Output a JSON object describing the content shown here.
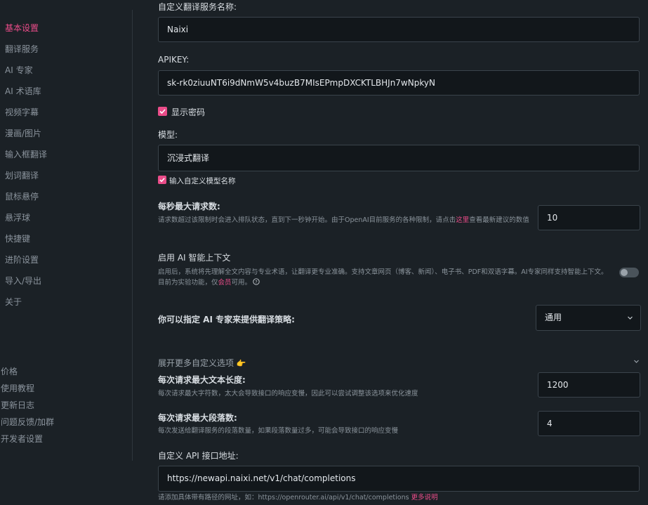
{
  "sidebar": {
    "items": [
      "基本设置",
      "翻译服务",
      "AI 专家",
      "AI 术语库",
      "视频字幕",
      "漫画/图片",
      "输入框翻译",
      "划词翻译",
      "鼠标悬停",
      "悬浮球",
      "快捷键",
      "进阶设置",
      "导入/导出",
      "关于"
    ],
    "bottom": [
      "价格",
      "使用教程",
      "更新日志",
      "问题反馈/加群",
      "开发者设置"
    ]
  },
  "form": {
    "service_name_label": "自定义翻译服务名称:",
    "service_name_value": "Naixi",
    "apikey_label": "APIKEY:",
    "apikey_value": "sk-rk0ziuuNT6i9dNmW5v4buzB7MIsEPmpDXCKTLBHJn7wNpkyN",
    "show_password_label": "显示密码",
    "model_label": "模型:",
    "model_value": "沉浸式翻译",
    "custom_model_label": "输入自定义模型名称",
    "max_rps_label": "每秒最大请求数:",
    "max_rps_desc_before": "请求数超过该限制时会进入排队状态，直到下一秒钟开始。由于OpenAI目前服务的各种限制，请点击",
    "max_rps_desc_link": "这里",
    "max_rps_desc_after": "查看最新建议的数值",
    "max_rps_value": "10",
    "ai_context_label": "启用 AI 智能上下文",
    "ai_context_desc_before": "启用后，系统将先理解全文内容与专业术语，让翻译更专业准确。支持文章网页（博客、新闻）、电子书、PDF和双语字幕。AI专家同样支持智能上下文。目前为实验功能，仅",
    "ai_context_desc_link": "会员",
    "ai_context_desc_after": "可用。",
    "ai_context_help_icon": "question-circle-icon",
    "ai_expert_label": "你可以指定 AI 专家来提供翻译策略:",
    "ai_expert_value": "通用",
    "more_options_label": "展开更多自定义选项",
    "more_options_emoji": "👉",
    "max_text_label": "每次请求最大文本长度:",
    "max_text_desc": "每次请求最大字符数，太大会导致接口的响应变慢，因此可以尝试调整该选项来优化速度",
    "max_text_value": "1200",
    "max_para_label": "每次请求最大段落数:",
    "max_para_desc": "每次发送给翻译服务的段落数量，如果段落数量过多，可能会导致接口的响应变慢",
    "max_para_value": "4",
    "api_url_label": "自定义 API 接口地址:",
    "api_url_value": "https://newapi.naixi.net/v1/chat/completions",
    "api_url_hint": "请添加具体带有路径的网址，如：https://openrouter.ai/api/v1/chat/completions",
    "api_url_hint_link": "更多说明"
  },
  "colors": {
    "accent": "#ea4c89",
    "bg": "#1b2126",
    "input_bg": "#12171b"
  },
  "state": {
    "show_password": true,
    "custom_model": true,
    "ai_context_enabled": false
  }
}
